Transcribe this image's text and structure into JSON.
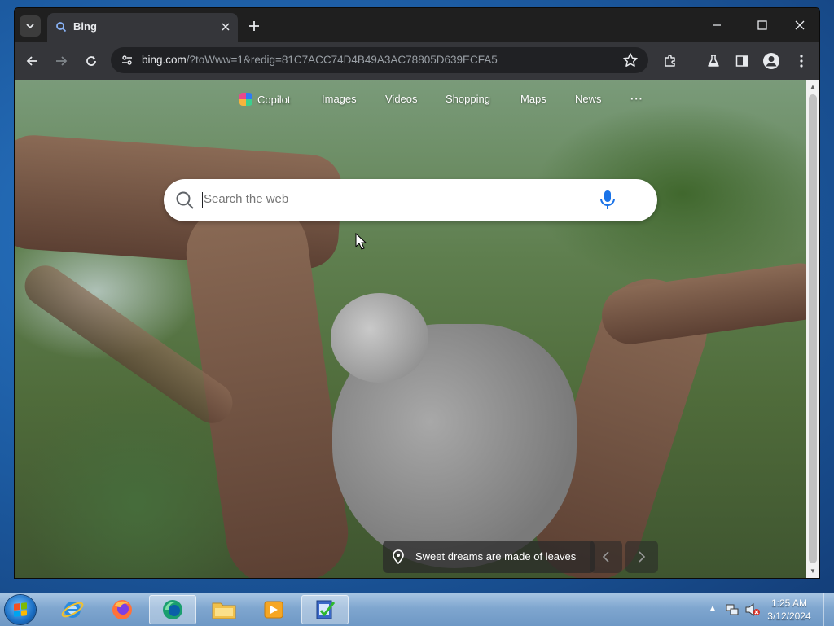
{
  "browser": {
    "tab": {
      "title": "Bing"
    },
    "address_bar": {
      "host": "bing.com",
      "path": "/?toWww=1&redig=81C7ACC74D4B49A3AC78805D639ECFA5"
    }
  },
  "bing": {
    "nav": [
      "Copilot",
      "Images",
      "Videos",
      "Shopping",
      "Maps",
      "News",
      "···"
    ],
    "search_placeholder": "Search the web",
    "caption": "Sweet dreams are made of leaves"
  },
  "taskbar": {
    "clock_time": "1:25 AM",
    "clock_date": "3/12/2024"
  },
  "colors": {
    "browser_dark": "#202124",
    "toolbar": "#35363a",
    "taskbar": "#7fa6cf",
    "mic_blue": "#1a73e8"
  }
}
